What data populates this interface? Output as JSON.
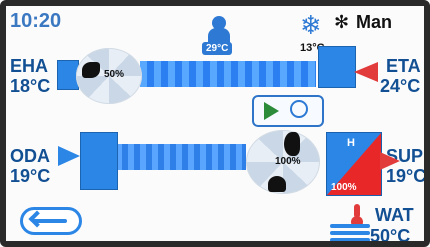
{
  "header": {
    "time": "10:20",
    "occupancy_temp": "29°C",
    "outside_temp": "13°C",
    "mode_label": "Man"
  },
  "labels": {
    "eha": "EHA",
    "eha_temp": "18°C",
    "eta": "ETA",
    "eta_temp": "24°C",
    "oda": "ODA",
    "oda_temp": "19°C",
    "sup": "SUP",
    "sup_temp": "19°C",
    "wat": "WAT",
    "wat_temp": "50°C"
  },
  "fans": {
    "exhaust_fan_pct": "50%",
    "supply_fan_pct": "100%"
  },
  "heater": {
    "label": "H",
    "pct": "100%"
  },
  "colors": {
    "accent": "#2b86e6",
    "heating": "#e82828",
    "play": "#2c8c3a"
  },
  "icons": {
    "play": "play-icon",
    "recovery": "heat-recovery-icon",
    "back": "back-arrow-icon",
    "snow": "snowflake-icon",
    "person": "person-icon",
    "gear": "gear-icon",
    "thermometer": "thermometer-icon",
    "water": "water-waves-icon"
  }
}
